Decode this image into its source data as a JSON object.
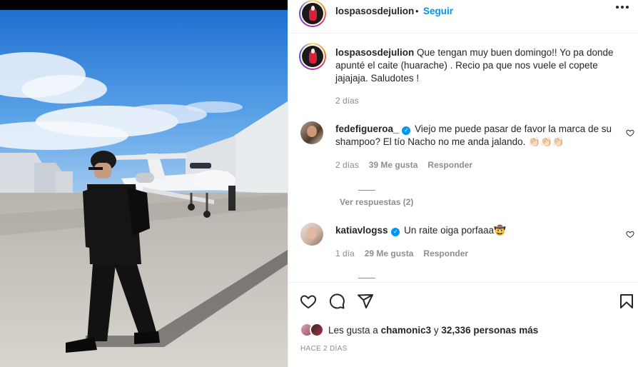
{
  "post": {
    "username": "lospasosdejulion",
    "follow_label": "Seguir",
    "separator": "•",
    "caption": "Que tengan muy buen domingo!! Yo pa donde apunté el caite (huarache) . Recio pa que nos vuele el copete jajajaja. Saludotes !",
    "caption_age": "2 días",
    "likes_prefix": "Les gusta a",
    "likes_user": "chamonic3",
    "likes_middle": "y",
    "likes_count": "32,336 personas más",
    "timestamp": "HACE 2 DÍAS"
  },
  "comments": [
    {
      "username": "fedefigueroa_",
      "text": "Viejo me puede pasar de favor la marca de su shampoo? El tío Nacho no me anda jalando. 👏🏻👏🏻👏🏻",
      "age": "2 días",
      "likes": "39 Me gusta",
      "reply_label": "Responder",
      "view_replies": "Ver respuestas (2)"
    },
    {
      "username": "katiavlogss",
      "text": "Un raite oiga porfaaa🤠",
      "age": "1 día",
      "likes": "29 Me gusta",
      "reply_label": "Responder"
    }
  ],
  "icons": {
    "more": "more-options-icon",
    "verified": "verified-badge-icon",
    "like": "heart-icon",
    "comment": "comment-icon",
    "share": "share-icon",
    "save": "bookmark-icon"
  },
  "colors": {
    "accent": "#0095f6",
    "text": "#262626",
    "muted": "#8e8e8e",
    "divider": "#efefef"
  }
}
